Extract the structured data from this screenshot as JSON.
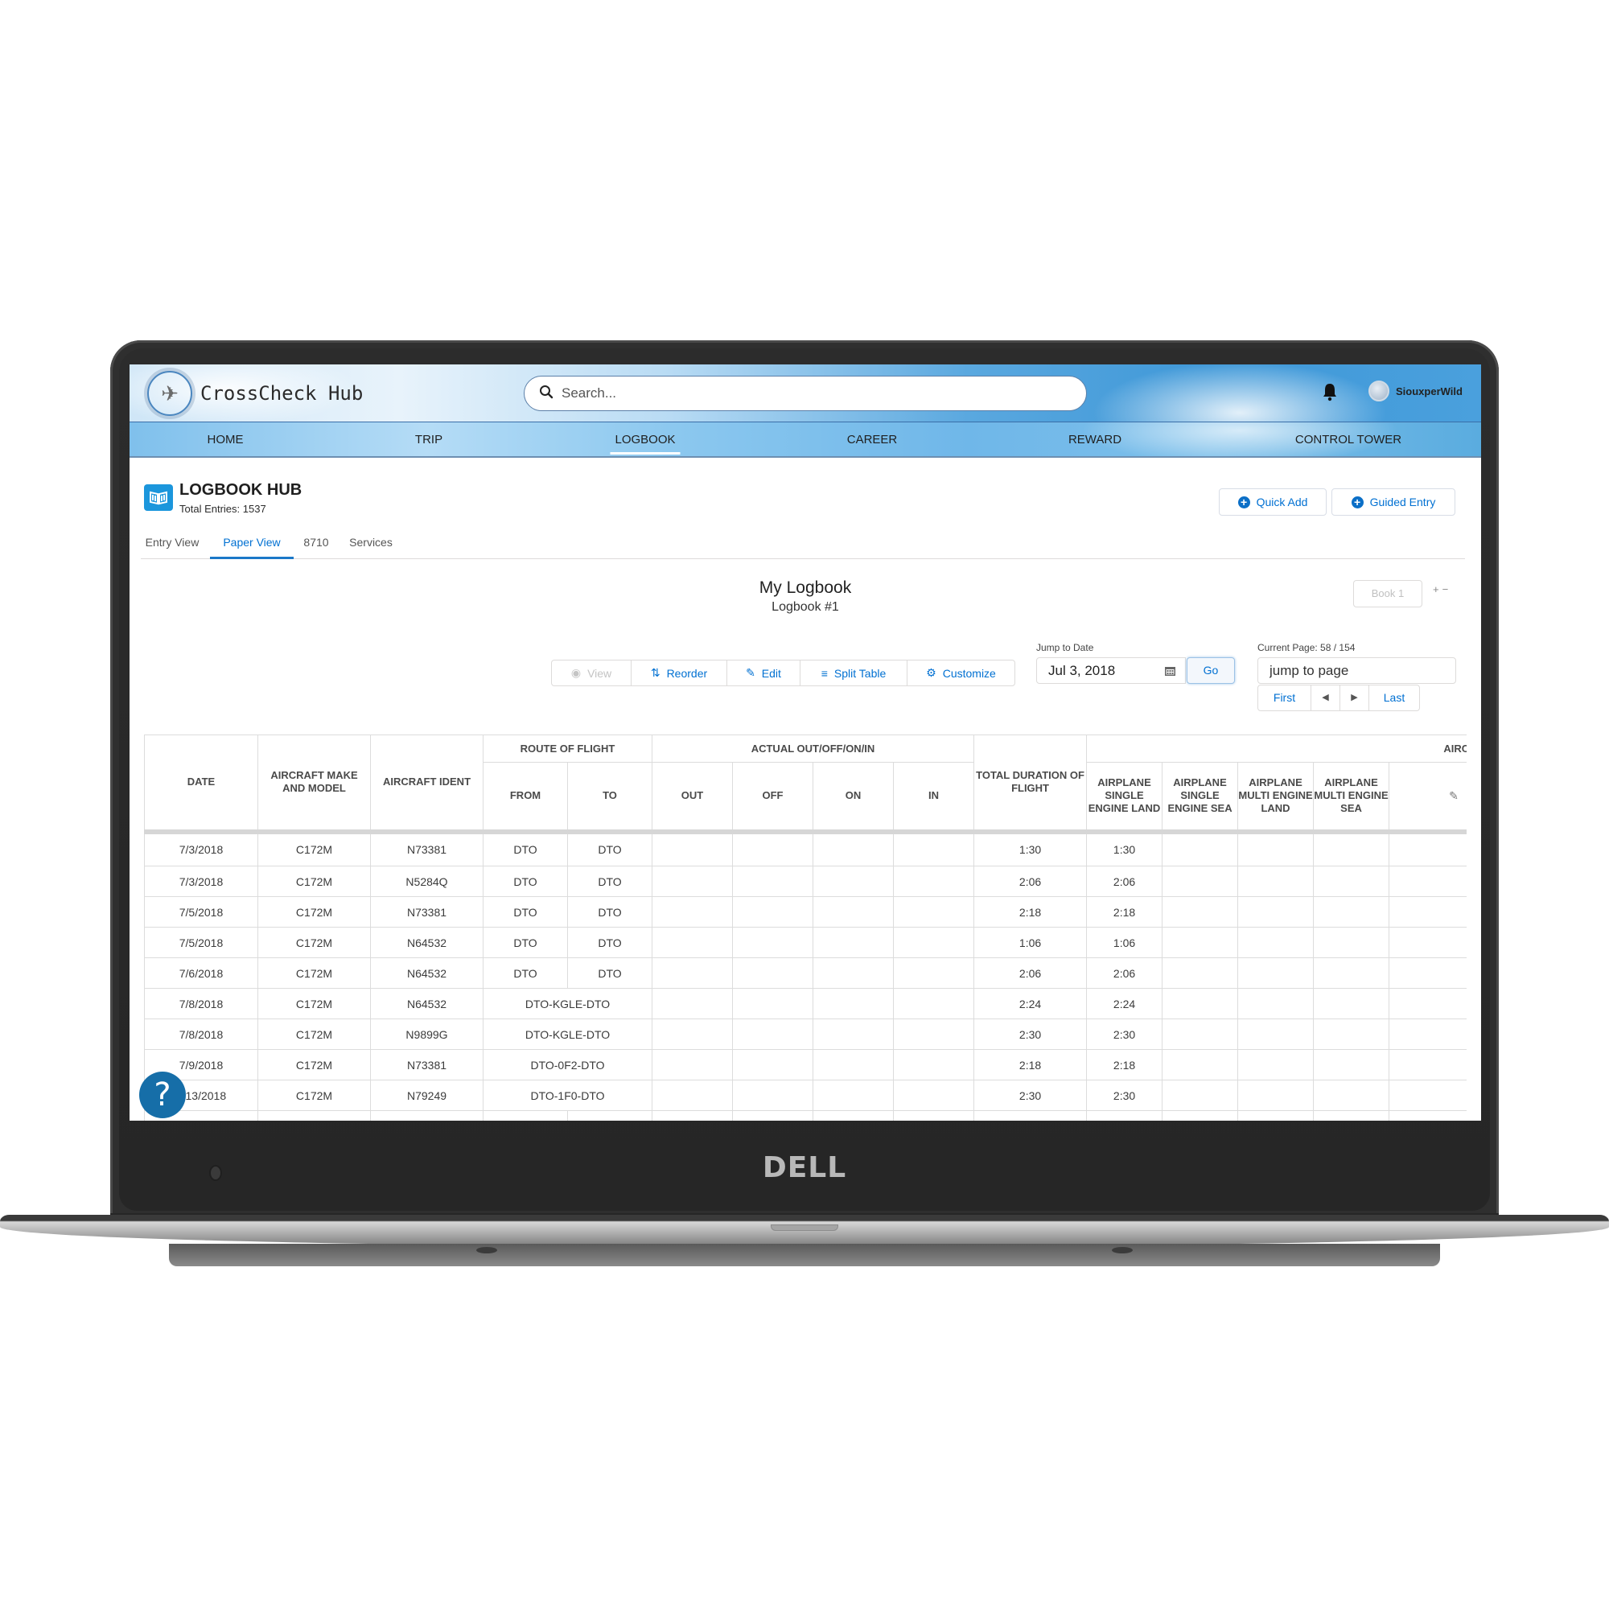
{
  "device": {
    "brand": "DELL"
  },
  "app": {
    "title": "CrossCheck Hub",
    "search": {
      "placeholder": "Search..."
    },
    "user": {
      "name": "SiouxperWild"
    }
  },
  "nav": {
    "items": [
      {
        "label": "HOME",
        "active": false
      },
      {
        "label": "TRIP",
        "active": false
      },
      {
        "label": "LOGBOOK",
        "active": true
      },
      {
        "label": "CAREER",
        "active": false
      },
      {
        "label": "REWARD",
        "active": false
      },
      {
        "label": "CONTROL TOWER",
        "active": false
      }
    ]
  },
  "page": {
    "title": "LOGBOOK HUB",
    "subtitle": "Total Entries: 1537",
    "actions": {
      "quick_add": "Quick Add",
      "guided_entry": "Guided Entry"
    },
    "tabs": [
      {
        "label": "Entry View",
        "active": false
      },
      {
        "label": "Paper View",
        "active": true
      },
      {
        "label": "8710",
        "active": false
      },
      {
        "label": "Services",
        "active": false
      }
    ]
  },
  "logbook": {
    "title": "My Logbook",
    "subtitle": "Logbook #1",
    "book_selector": "Book 1",
    "add_symbol": "+",
    "remove_symbol": "−",
    "toolbar": {
      "view": "View",
      "reorder": "Reorder",
      "edit": "Edit",
      "split_table": "Split Table",
      "customize": "Customize"
    },
    "jump_to_date": {
      "label": "Jump to Date",
      "value": "Jul 3, 2018",
      "go": "Go"
    },
    "pagination": {
      "label": "Current Page: 58 / 154",
      "current_page": 58,
      "total_pages": 154,
      "jump_placeholder": "jump to page",
      "first": "First",
      "prev": "◀",
      "next": "▶",
      "last": "Last"
    }
  },
  "table": {
    "group_headers": {
      "route": "ROUTE OF FLIGHT",
      "actual": "ACTUAL OUT/OFF/ON/IN",
      "aircraft_category": "AIRCRAFT CATEGO"
    },
    "headers": {
      "date": "DATE",
      "make_model": "AIRCRAFT MAKE AND MODEL",
      "ident": "AIRCRAFT IDENT",
      "from": "FROM",
      "to": "TO",
      "out": "OUT",
      "off": "OFF",
      "on": "ON",
      "in": "IN",
      "total": "TOTAL DURATION OF FLIGHT",
      "asel": "AIRPLANE SINGLE ENGINE LAND",
      "ases": "AIRPLANE SINGLE ENGINE SEA",
      "amel": "AIRPLANE MULTI ENGINE LAND",
      "ames": "AIRPLANE MULTI ENGINE SEA"
    },
    "rows": [
      {
        "date": "7/3/2018",
        "model": "C172M",
        "ident": "N73381",
        "from": "DTO",
        "to": "DTO",
        "route": "",
        "out": "",
        "off": "",
        "on": "",
        "in": "",
        "total": "1:30",
        "asel": "1:30",
        "ases": "",
        "amel": "",
        "ames": ""
      },
      {
        "date": "7/3/2018",
        "model": "C172M",
        "ident": "N5284Q",
        "from": "DTO",
        "to": "DTO",
        "route": "",
        "out": "",
        "off": "",
        "on": "",
        "in": "",
        "total": "2:06",
        "asel": "2:06",
        "ases": "",
        "amel": "",
        "ames": ""
      },
      {
        "date": "7/5/2018",
        "model": "C172M",
        "ident": "N73381",
        "from": "DTO",
        "to": "DTO",
        "route": "",
        "out": "",
        "off": "",
        "on": "",
        "in": "",
        "total": "2:18",
        "asel": "2:18",
        "ases": "",
        "amel": "",
        "ames": ""
      },
      {
        "date": "7/5/2018",
        "model": "C172M",
        "ident": "N64532",
        "from": "DTO",
        "to": "DTO",
        "route": "",
        "out": "",
        "off": "",
        "on": "",
        "in": "",
        "total": "1:06",
        "asel": "1:06",
        "ases": "",
        "amel": "",
        "ames": ""
      },
      {
        "date": "7/6/2018",
        "model": "C172M",
        "ident": "N64532",
        "from": "DTO",
        "to": "DTO",
        "route": "",
        "out": "",
        "off": "",
        "on": "",
        "in": "",
        "total": "2:06",
        "asel": "2:06",
        "ases": "",
        "amel": "",
        "ames": ""
      },
      {
        "date": "7/8/2018",
        "model": "C172M",
        "ident": "N64532",
        "from": "",
        "to": "",
        "route": "DTO-KGLE-DTO",
        "out": "",
        "off": "",
        "on": "",
        "in": "",
        "total": "2:24",
        "asel": "2:24",
        "ases": "",
        "amel": "",
        "ames": ""
      },
      {
        "date": "7/8/2018",
        "model": "C172M",
        "ident": "N9899G",
        "from": "",
        "to": "",
        "route": "DTO-KGLE-DTO",
        "out": "",
        "off": "",
        "on": "",
        "in": "",
        "total": "2:30",
        "asel": "2:30",
        "ases": "",
        "amel": "",
        "ames": ""
      },
      {
        "date": "7/9/2018",
        "model": "C172M",
        "ident": "N73381",
        "from": "",
        "to": "",
        "route": "DTO-0F2-DTO",
        "out": "",
        "off": "",
        "on": "",
        "in": "",
        "total": "2:18",
        "asel": "2:18",
        "ases": "",
        "amel": "",
        "ames": ""
      },
      {
        "date": "7/13/2018",
        "model": "C172M",
        "ident": "N79249",
        "from": "",
        "to": "",
        "route": "DTO-1F0-DTO",
        "out": "",
        "off": "",
        "on": "",
        "in": "",
        "total": "2:30",
        "asel": "2:30",
        "ases": "",
        "amel": "",
        "ames": ""
      }
    ]
  },
  "help": {
    "symbol": "?"
  },
  "colors": {
    "accent": "#0070d2",
    "hub_icon": "#1b96dc",
    "help_button": "#166ea8",
    "header_sky": "#4aa0dd"
  }
}
